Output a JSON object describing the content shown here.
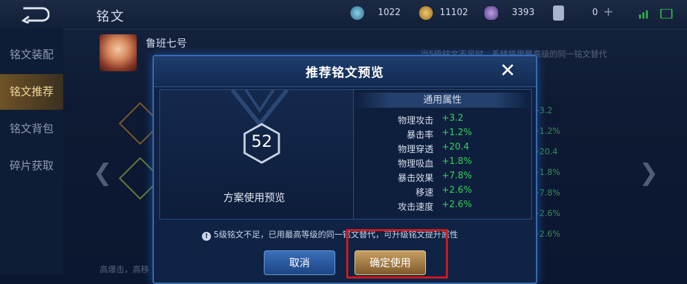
{
  "header": {
    "title": "铭文",
    "resources": [
      {
        "icon": "diamond-icon",
        "value": "1022"
      },
      {
        "icon": "gold-coin-icon",
        "value": "11102"
      },
      {
        "icon": "rune-fragment-icon",
        "value": "3393"
      },
      {
        "icon": "card-icon",
        "value": "0"
      }
    ],
    "add_label": "+"
  },
  "sidebar": {
    "items": [
      {
        "label": "铭文装配"
      },
      {
        "label": "铭文推荐"
      },
      {
        "label": "铭文背包"
      },
      {
        "label": "碎片获取"
      }
    ],
    "active_index": 1
  },
  "hero": {
    "name": "鲁班七号",
    "note": "当5级铭文不足时，系统将用最高级的同一铭文替代"
  },
  "behind_stats": [
    "+3.2",
    "+1.2%",
    "+20.4",
    "+1.8%",
    "+7.8%",
    "+2.6%",
    "+2.6%"
  ],
  "behind_bottom_text": "高爆击，高移",
  "dialog": {
    "title": "推荐铭文预览",
    "close_label": "✕",
    "level": "52",
    "preview_label": "方案使用预览",
    "stats_header": "通用属性",
    "stats": [
      {
        "name": "物理攻击",
        "value": "+3.2"
      },
      {
        "name": "暴击率",
        "value": "+1.2%"
      },
      {
        "name": "物理穿透",
        "value": "+20.4"
      },
      {
        "name": "物理吸血",
        "value": "+1.8%"
      },
      {
        "name": "暴击效果",
        "value": "+7.8%"
      },
      {
        "name": "移速",
        "value": "+2.6%"
      },
      {
        "name": "攻击速度",
        "value": "+2.6%"
      }
    ],
    "warning": "5级铭文不足，已用最高等级的同一铭文替代，可升级铭文提升属性",
    "cancel_label": "取消",
    "confirm_label": "确定使用"
  },
  "colors": {
    "accent_gold": "#c9a063",
    "accent_blue": "#3a6fb8",
    "stat_positive": "#38d05a",
    "highlight_red": "#d6161a"
  }
}
